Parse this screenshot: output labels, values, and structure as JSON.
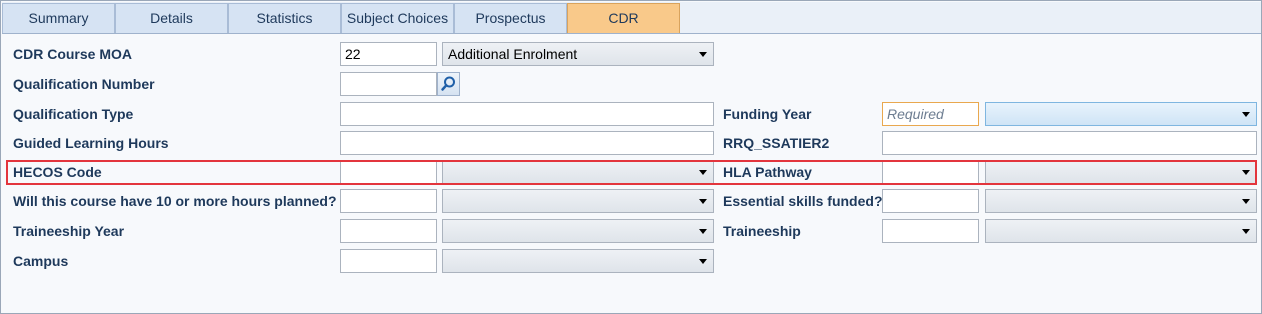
{
  "tabs": [
    "Summary",
    "Details",
    "Statistics",
    "Subject Choices",
    "Prospectus",
    "CDR"
  ],
  "active_tab": "CDR",
  "colors": {
    "active_tab": "#f9c98a",
    "highlight_border": "#e3353d",
    "required_border": "#e9a84f",
    "label": "#1e395b"
  },
  "form": {
    "cdr_course_moa": {
      "label": "CDR Course MOA",
      "value": "22",
      "select": "Additional Enrolment"
    },
    "qualification_number": {
      "label": "Qualification Number",
      "value": "",
      "button_icon": "search-icon"
    },
    "qualification_type": {
      "label": "Qualification Type",
      "value": ""
    },
    "guided_learning_hours": {
      "label": "Guided Learning Hours",
      "value": ""
    },
    "hecos_code": {
      "label": "HECOS Code",
      "value": "",
      "select": ""
    },
    "ten_hours_planned": {
      "label": "Will this course have 10 or more hours planned?",
      "value": "",
      "select": ""
    },
    "traineeship_year": {
      "label": "Traineeship Year",
      "value": "",
      "select": ""
    },
    "campus": {
      "label": "Campus",
      "value": "",
      "select": ""
    },
    "funding_year": {
      "label": "Funding Year",
      "placeholder": "Required",
      "select": ""
    },
    "rrq_ssatier2": {
      "label": "RRQ_SSATIER2",
      "value": ""
    },
    "hla_pathway": {
      "label": "HLA Pathway",
      "value": "",
      "select": ""
    },
    "essential_skills_funded": {
      "label": "Essential skills funded?",
      "value": "",
      "select": ""
    },
    "traineeship": {
      "label": "Traineeship",
      "value": "",
      "select": ""
    }
  }
}
